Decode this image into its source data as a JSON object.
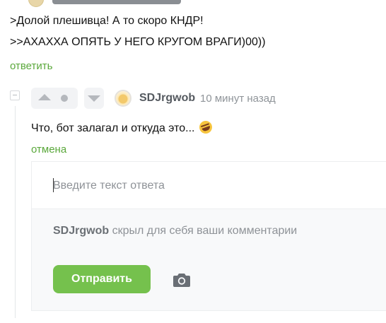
{
  "quoted_comment": {
    "line1": ">Долой плешивца! А то скоро КНДР!",
    "line2": ">>АХАХХА ОПЯТЬ У НЕГО КРУГОМ ВРАГИ)00))",
    "reply_link": "ответить"
  },
  "comment": {
    "author": "SDJrgwob",
    "time": "10 минут назад",
    "text": "Что, бот залагал и откуда это...",
    "emoji": "rofl-emoji",
    "cancel_link": "отмена"
  },
  "reply_form": {
    "placeholder": "Введите текст ответа",
    "note_author": "SDJrgwob",
    "note_text": " скрыл для себя ваши комментарии",
    "send_label": "Отправить",
    "camera_icon": "camera-icon"
  },
  "colors": {
    "accent_green": "#75c14d",
    "link_green": "#5aa83b"
  }
}
